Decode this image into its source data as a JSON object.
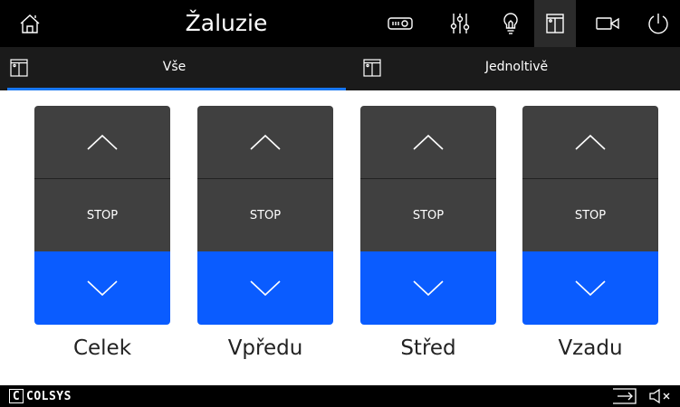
{
  "header": {
    "title": "Žaluzie",
    "icons": [
      "home-icon",
      "projector-icon",
      "mixer-icon",
      "light-bulb-icon",
      "blinds-icon",
      "camera-icon",
      "power-icon"
    ],
    "active_icon": "blinds-icon"
  },
  "tabs": [
    {
      "label": "Vše",
      "icon": "blinds-icon",
      "selected": true
    },
    {
      "label": "Jednoltivě",
      "icon": "blinds-icon",
      "selected": false
    }
  ],
  "blinds": [
    {
      "label": "Celek",
      "stop_label": "STOP"
    },
    {
      "label": "Vpředu",
      "stop_label": "STOP"
    },
    {
      "label": "Střed",
      "stop_label": "STOP"
    },
    {
      "label": "Vzadu",
      "stop_label": "STOP"
    }
  ],
  "footer": {
    "logo_letter": "C",
    "logo_text": "COLSYS",
    "icons": [
      "exit-icon",
      "mute-icon"
    ]
  },
  "colors": {
    "accent": "#1877f2",
    "down_button": "#0a5cff",
    "button_gray": "#404040",
    "bar": "#000000"
  }
}
